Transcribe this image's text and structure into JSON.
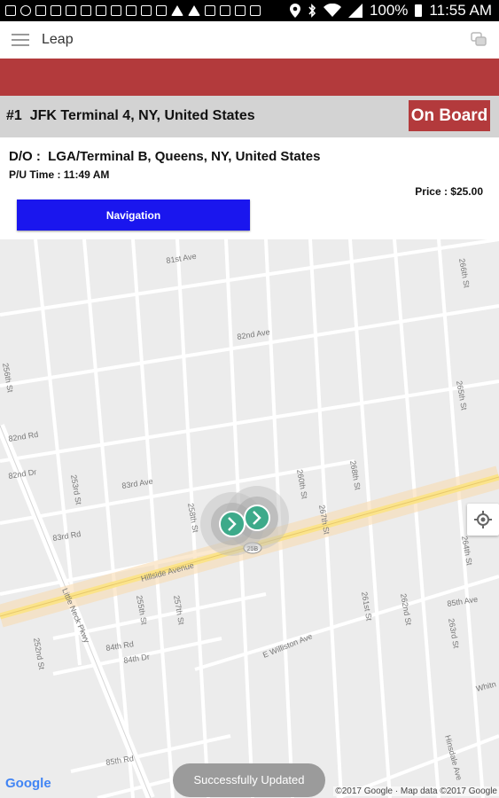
{
  "status_bar": {
    "battery": "100%",
    "time": "11:55 AM",
    "left_icons": [
      "notification-icon",
      "skype-icon",
      "messaging-icon",
      "mail-icon",
      "download-icon",
      "download-icon",
      "download-icon",
      "download-icon",
      "image-icon",
      "image-icon",
      "image-icon",
      "warning-icon",
      "warning-icon",
      "image-icon",
      "download-icon",
      "image-icon",
      "mail-icon"
    ],
    "right_icons": [
      "location-icon",
      "bluetooth-icon",
      "wifi-icon",
      "signal-icon",
      "battery-icon"
    ]
  },
  "app_bar": {
    "title": "Leap"
  },
  "trip": {
    "title": "#1  JFK Terminal 4, NY, United States",
    "status_button": "On Board",
    "dropoff": "D/O :  LGA/Terminal B, Queens, NY, United States",
    "pickup_time": "P/U Time : 11:49 AM",
    "price": "Price : $25.00",
    "navigation_button": "Navigation"
  },
  "map": {
    "streets": [
      "81st Ave",
      "82nd Ave",
      "83rd Ave",
      "84th Rd",
      "84th Dr",
      "85th Ave",
      "82nd Rd",
      "82nd Dr",
      "83rd Rd",
      "85th Rd",
      "Hillside Avenue",
      "E Williston Ave",
      "Little Neck Pkwy",
      "252nd St",
      "253rd St",
      "255th St",
      "256th St",
      "257th St",
      "258th St",
      "260th St",
      "261st St",
      "262nd St",
      "263rd St",
      "264th St",
      "265th St",
      "266th St",
      "267th St",
      "268th St",
      "Hinsdale Ave",
      "Whitn"
    ],
    "route_shield": "25B",
    "attribution_left": "Google",
    "attribution_right": "©2017 Google · Map data ©2017 Google"
  },
  "toast": "Successfully Updated",
  "colors": {
    "brand_red": "#b33a3c",
    "nav_blue": "#1a16ee",
    "marker_green": "#3daa8a",
    "road_yellow": "#fbe38a"
  }
}
